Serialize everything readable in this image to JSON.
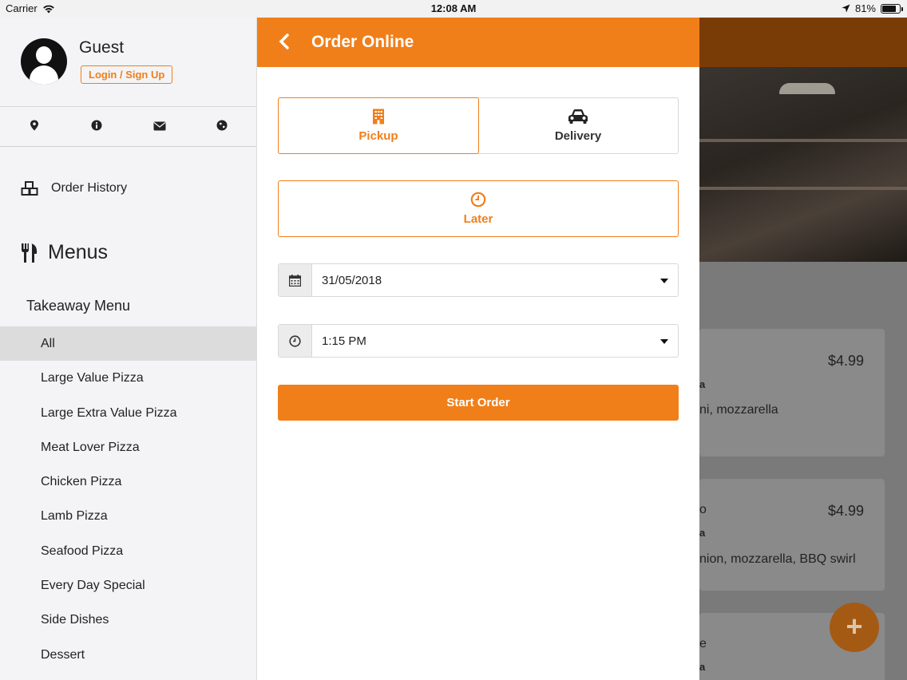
{
  "status_bar": {
    "carrier": "Carrier",
    "time": "12:08 AM",
    "battery_percent": "81%",
    "battery_level": 0.81
  },
  "sidebar": {
    "guest_name": "Guest",
    "login_label": "Login / Sign Up",
    "icons": [
      "map-marker-icon",
      "info-icon",
      "envelope-icon",
      "globe-icon"
    ],
    "order_history_label": "Order History",
    "menus_title": "Menus",
    "takeaway_menu_label": "Takeaway Menu",
    "menu_items": [
      "All",
      "Large Value Pizza",
      "Large Extra Value Pizza",
      "Meat Lover Pizza",
      "Chicken Pizza",
      "Lamb Pizza",
      "Seafood Pizza",
      "Every Day Special",
      "Side Dishes",
      "Dessert"
    ],
    "active_item": "All"
  },
  "order_modal": {
    "title": "Order Online",
    "pickup_label": "Pickup",
    "delivery_label": "Delivery",
    "selected_type": "Pickup",
    "later_label": "Later",
    "date_value": "31/05/2018",
    "time_value": "1:15 PM",
    "start_order_label": "Start Order"
  },
  "background_cards": [
    {
      "price": "$4.99",
      "line1": "a",
      "line2": "ni, mozzarella"
    },
    {
      "price": "$4.99",
      "line0": "o",
      "line1": "a",
      "line2": "nion, mozzarella, BBQ swirl"
    },
    {
      "price": "$",
      "line0": "e",
      "line1": "a"
    }
  ],
  "colors": {
    "accent": "#f07f1a",
    "sidebar_bg": "#f4f4f6",
    "active_item_bg": "#dcdcdc"
  }
}
